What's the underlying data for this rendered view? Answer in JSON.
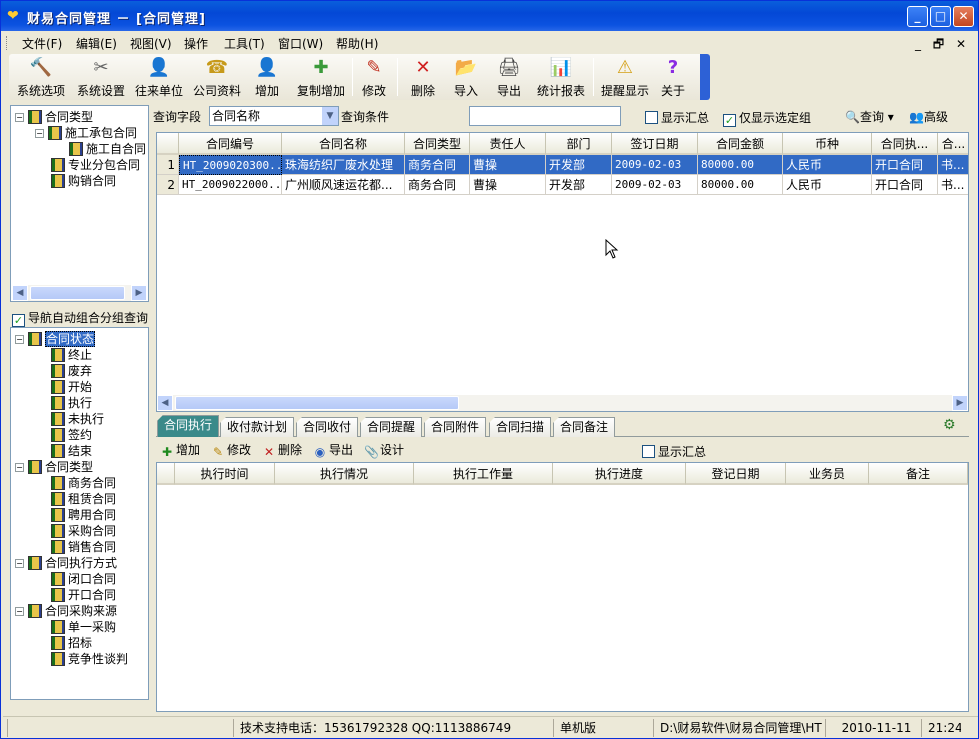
{
  "window": {
    "title": "财易合同管理 － [合同管理]",
    "min": "_",
    "max": "□",
    "close": "✕"
  },
  "menu": [
    "文件(F)",
    "编辑(E)",
    "视图(V)",
    "操作",
    "工具(T)",
    "窗口(W)",
    "帮助(H)"
  ],
  "mdi_controls": "_ 🗗 ✕",
  "toolbar": [
    {
      "label": "系统选项",
      "icon": "hammer-icon"
    },
    {
      "label": "系统设置",
      "icon": "tools-icon"
    },
    {
      "label": "往来单位",
      "icon": "person-icon"
    },
    {
      "label": "公司资料",
      "icon": "phone-icon"
    },
    {
      "label": "增加",
      "icon": "add-user-icon"
    },
    {
      "label": "复制增加",
      "icon": "copy-add-icon"
    },
    {
      "label": "修改",
      "icon": "pencil-icon"
    },
    {
      "label": "删除",
      "icon": "delete-icon"
    },
    {
      "label": "导入",
      "icon": "import-icon"
    },
    {
      "label": "导出",
      "icon": "export-icon"
    },
    {
      "label": "统计报表",
      "icon": "chart-icon"
    },
    {
      "label": "提醒显示",
      "icon": "warning-icon"
    },
    {
      "label": "关于",
      "icon": "help-icon"
    }
  ],
  "top_tree": [
    {
      "label": "合同类型",
      "level": 0,
      "exp": "−"
    },
    {
      "label": "施工承包合同",
      "level": 1,
      "exp": "−"
    },
    {
      "label": "施工自合同",
      "level": 2,
      "exp": ""
    },
    {
      "label": "专业分包合同",
      "level": 1,
      "exp": ""
    },
    {
      "label": "购销合同",
      "level": 1,
      "exp": ""
    }
  ],
  "nav_auto_group": {
    "label": "导航自动组合分组查询",
    "checked": "✓"
  },
  "bottom_tree": [
    {
      "label": "合同状态",
      "level": 0,
      "exp": "−",
      "selected": true
    },
    {
      "label": "终止",
      "level": 1,
      "exp": ""
    },
    {
      "label": "废弃",
      "level": 1,
      "exp": ""
    },
    {
      "label": "开始",
      "level": 1,
      "exp": ""
    },
    {
      "label": "执行",
      "level": 1,
      "exp": ""
    },
    {
      "label": "未执行",
      "level": 1,
      "exp": ""
    },
    {
      "label": "签约",
      "level": 1,
      "exp": ""
    },
    {
      "label": "结束",
      "level": 1,
      "exp": ""
    },
    {
      "label": "合同类型",
      "level": 0,
      "exp": "−"
    },
    {
      "label": "商务合同",
      "level": 1,
      "exp": ""
    },
    {
      "label": "租赁合同",
      "level": 1,
      "exp": ""
    },
    {
      "label": "聘用合同",
      "level": 1,
      "exp": ""
    },
    {
      "label": "采购合同",
      "level": 1,
      "exp": ""
    },
    {
      "label": "销售合同",
      "level": 1,
      "exp": ""
    },
    {
      "label": "合同执行方式",
      "level": 0,
      "exp": "−"
    },
    {
      "label": "闭口合同",
      "level": 1,
      "exp": ""
    },
    {
      "label": "开口合同",
      "level": 1,
      "exp": ""
    },
    {
      "label": "合同采购来源",
      "level": 0,
      "exp": "−"
    },
    {
      "label": "单一采购",
      "level": 1,
      "exp": ""
    },
    {
      "label": "招标",
      "level": 1,
      "exp": ""
    },
    {
      "label": "竞争性谈判",
      "level": 1,
      "exp": ""
    }
  ],
  "query": {
    "field_label": "查询字段",
    "field_value": "合同名称",
    "cond_label": "查询条件",
    "cond_value": "",
    "show_summary": "显示汇总",
    "only_selected": "仅显示选定组",
    "only_selected_check": "✓",
    "search": "查询",
    "advanced": "高级"
  },
  "grid": {
    "columns": [
      "合同编号",
      "合同名称",
      "合同类型",
      "责任人",
      "部门",
      "签订日期",
      "合同金额",
      "币种",
      "合同执...",
      "合..."
    ],
    "rows": [
      {
        "no": "1",
        "cells": [
          "HT_2009020300...",
          "珠海纺织厂废水处理",
          "商务合同",
          "曹操",
          "开发部",
          "2009-02-03",
          "80000.00",
          "人民币",
          "开口合同",
          "书..."
        ]
      },
      {
        "no": "2",
        "cells": [
          "HT_2009022000...",
          "广州顺风速运花都...",
          "商务合同",
          "曹操",
          "开发部",
          "2009-02-03",
          "80000.00",
          "人民币",
          "开口合同",
          "书..."
        ]
      }
    ]
  },
  "tabs": [
    "合同执行",
    "收付款计划",
    "合同收付",
    "合同提醒",
    "合同附件",
    "合同扫描",
    "合同备注"
  ],
  "subtoolbar": {
    "add": "增加",
    "edit": "修改",
    "delete": "删除",
    "export": "导出",
    "design": "设计",
    "show_summary": "显示汇总"
  },
  "grid2_columns": [
    "执行时间",
    "执行情况",
    "执行工作量",
    "执行进度",
    "登记日期",
    "业务员",
    "备注"
  ],
  "status": {
    "support": "技术支持电话：15361792328 QQ:1113886749",
    "edition": "单机版",
    "path": "D:\\财易软件\\财易合同管理\\HT",
    "date": "2010-11-11",
    "time": "21:24"
  }
}
